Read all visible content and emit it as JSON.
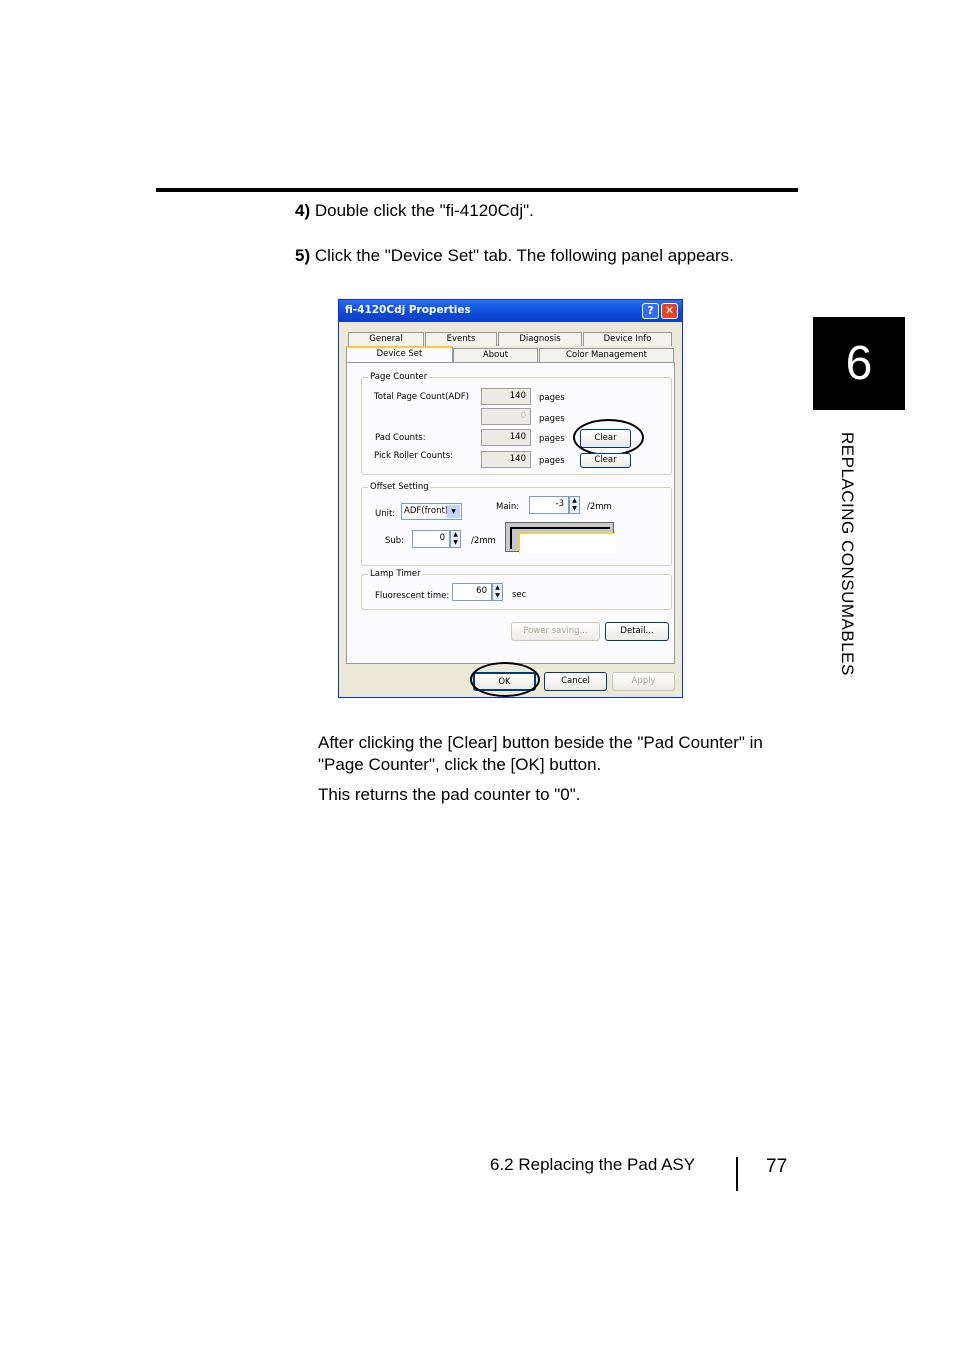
{
  "steps": [
    {
      "num": "4)",
      "text": "Double click the \"fi-4120Cdj\"."
    },
    {
      "num": "5)",
      "text": "Click the \"Device Set\" tab. The following panel appears."
    }
  ],
  "paragraphs": [
    "After clicking the [Clear] button beside the \"Pad Counter\" in \"Page Counter\", click the [OK] button.",
    "This returns the pad counter to \"0\"."
  ],
  "chapter": {
    "number": "6",
    "title": "REPLACING CONSUMABLES"
  },
  "footer": {
    "section": "6.2  Replacing the Pad ASY",
    "page": "77"
  },
  "dialog": {
    "title": "fi-4120Cdj Properties",
    "help_glyph": "?",
    "close_glyph": "✕",
    "tabs_row1": [
      "General",
      "Events",
      "Diagnosis",
      "Device Info"
    ],
    "tabs_row2": [
      "Device Set",
      "About",
      "Color Management"
    ],
    "page_counter": {
      "title": "Page Counter",
      "rows": [
        {
          "label": "Total Page Count(ADF)",
          "value": "140",
          "unit": "pages"
        },
        {
          "label": "",
          "value": "0",
          "unit": "pages"
        },
        {
          "label": "Pad Counts:",
          "value": "140",
          "unit": "pages"
        },
        {
          "label": "Pick Roller Counts:",
          "value": "140",
          "unit": "pages"
        }
      ],
      "clear_label": "Clear"
    },
    "offset": {
      "title": "Offset Setting",
      "unit_label": "Unit:",
      "unit_value": "ADF(front)",
      "main_label": "Main:",
      "main_value": "-3",
      "main_unit": "/2mm",
      "sub_label": "Sub:",
      "sub_value": "0",
      "sub_unit": "/2mm"
    },
    "lamp": {
      "title": "Lamp Timer",
      "label": "Fluorescent time:",
      "value": "60",
      "unit": "sec"
    },
    "power_saving_label": "Power saving...",
    "detail_label": "Detail...",
    "ok_label": "OK",
    "cancel_label": "Cancel",
    "apply_label": "Apply"
  }
}
